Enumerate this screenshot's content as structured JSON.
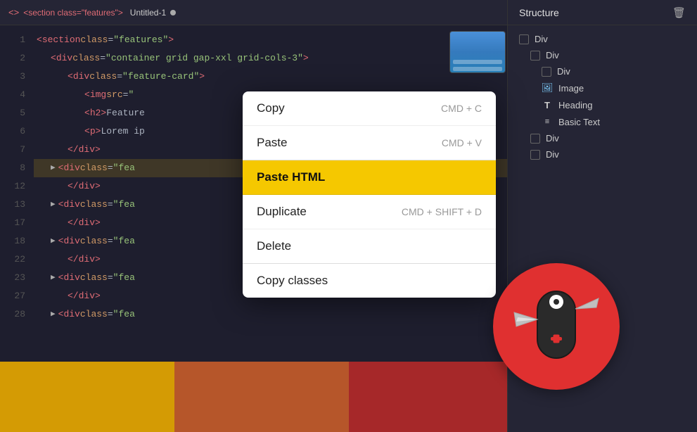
{
  "tab": {
    "tag": "<section class=\"features\">",
    "filename": "Untitled-1",
    "dot_color": "#aaa"
  },
  "editor": {
    "lines": [
      {
        "num": 1,
        "indent": 1,
        "content": "<section class=\"features\">",
        "arrow": false,
        "highlighted": false
      },
      {
        "num": 2,
        "indent": 2,
        "content": "<div class=\"container grid gap-xxl grid-cols-3\">",
        "arrow": false,
        "highlighted": false
      },
      {
        "num": 3,
        "indent": 3,
        "content": "<div class=\"feature-card\">",
        "arrow": false,
        "highlighted": false
      },
      {
        "num": 4,
        "indent": 4,
        "content": "<img src=\"",
        "arrow": false,
        "highlighted": false
      },
      {
        "num": 5,
        "indent": 4,
        "content": "<h2>Feature",
        "arrow": false,
        "highlighted": false
      },
      {
        "num": 6,
        "indent": 4,
        "content": "<p>Lorem ip",
        "arrow": false,
        "highlighted": false
      },
      {
        "num": 7,
        "indent": 3,
        "content": "</div>",
        "arrow": false,
        "highlighted": false
      },
      {
        "num": 8,
        "indent": 2,
        "content": "<div class=\"fea",
        "arrow": true,
        "highlighted": true
      },
      {
        "num": 12,
        "indent": 3,
        "content": "</div>",
        "arrow": false,
        "highlighted": false
      },
      {
        "num": 13,
        "indent": 2,
        "content": "<div class=\"fea",
        "arrow": true,
        "highlighted": false
      },
      {
        "num": 17,
        "indent": 3,
        "content": "</div>",
        "arrow": false,
        "highlighted": false
      },
      {
        "num": 18,
        "indent": 2,
        "content": "<div class=\"fea",
        "arrow": true,
        "highlighted": false
      },
      {
        "num": 22,
        "indent": 3,
        "content": "</div>",
        "arrow": false,
        "highlighted": false
      },
      {
        "num": 23,
        "indent": 2,
        "content": "<div class=\"fea",
        "arrow": true,
        "highlighted": false
      },
      {
        "num": 27,
        "indent": 3,
        "content": "</div>",
        "arrow": false,
        "highlighted": false
      },
      {
        "num": 28,
        "indent": 2,
        "content": "<div class=\"fea",
        "arrow": true,
        "highlighted": false
      }
    ]
  },
  "panel": {
    "title": "Structure",
    "items": [
      {
        "level": 0,
        "type": "checkbox",
        "label": "Div"
      },
      {
        "level": 1,
        "type": "checkbox",
        "label": "Div"
      },
      {
        "level": 2,
        "type": "checkbox",
        "label": "Div"
      },
      {
        "level": 2,
        "type": "image",
        "label": "Image"
      },
      {
        "level": 2,
        "type": "text-t",
        "label": "Heading"
      },
      {
        "level": 2,
        "type": "lines",
        "label": "Basic Text"
      },
      {
        "level": 1,
        "type": "checkbox",
        "label": "Div"
      },
      {
        "level": 1,
        "type": "checkbox",
        "label": "Div"
      }
    ]
  },
  "context_menu": {
    "items": [
      {
        "label": "Copy",
        "shortcut": "CMD + C",
        "active": false,
        "divider_after": false
      },
      {
        "label": "Paste",
        "shortcut": "CMD + V",
        "active": false,
        "divider_after": true
      },
      {
        "label": "Paste HTML",
        "shortcut": "",
        "active": true,
        "divider_after": true
      },
      {
        "label": "Duplicate",
        "shortcut": "CMD + SHIFT + D",
        "active": false,
        "divider_after": false
      },
      {
        "label": "Delete",
        "shortcut": "",
        "active": false,
        "divider_after": true
      },
      {
        "label": "Copy classes",
        "shortcut": "",
        "active": false,
        "divider_after": false
      }
    ]
  },
  "colors": {
    "accent_yellow": "#f5c800",
    "accent_red": "#e03030",
    "editor_bg": "#1e1e2e",
    "panel_bg": "#252535"
  }
}
